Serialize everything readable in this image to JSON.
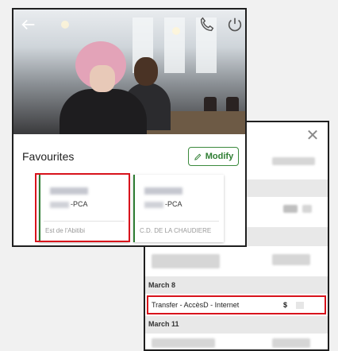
{
  "transactions_panel": {
    "close_icon": "close-icon",
    "dates": [
      "March 8",
      "March 11"
    ],
    "highlighted_transaction": {
      "label": "Transfer - AccèsD - Internet",
      "amount_symbol": "$"
    }
  },
  "favourites_card": {
    "back_icon": "arrow-left-icon",
    "phone_icon": "phone-icon",
    "power_icon": "power-icon",
    "title": "Favourites",
    "modify_label": "Modify",
    "accounts": [
      {
        "suffix": "-PCA",
        "branch": "Est de l'Abitibi"
      },
      {
        "suffix": "-PCA",
        "branch": "C.D. DE LA CHAUDIERE"
      }
    ]
  },
  "colors": {
    "highlight": "#d8131c",
    "accent_green": "#2e7d32"
  }
}
